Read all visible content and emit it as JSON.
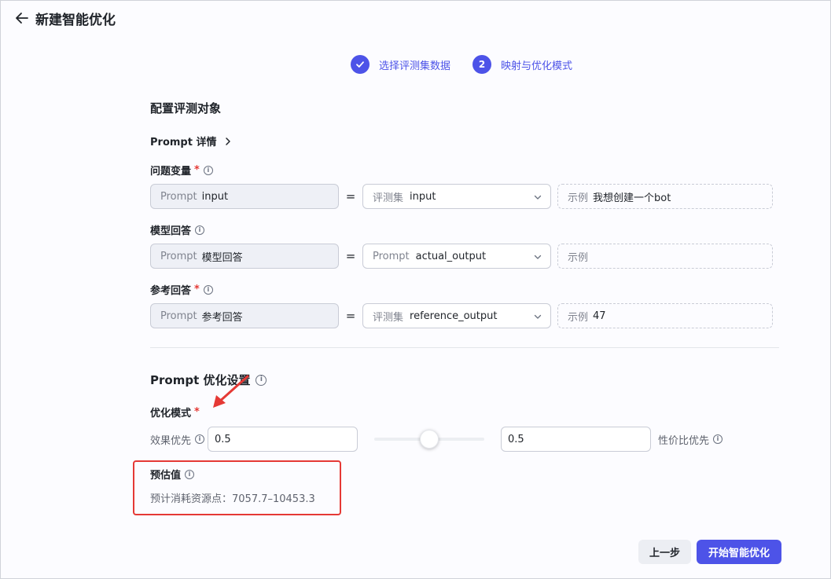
{
  "header": {
    "title": "新建智能优化"
  },
  "steps": [
    {
      "label": "选择评测集数据",
      "state": "done"
    },
    {
      "label": "映射与优化模式",
      "number": "2",
      "state": "active"
    }
  ],
  "eval_object": {
    "title": "配置评测对象",
    "prompt_detail": "Prompt 详情",
    "fields": [
      {
        "label": "问题变量",
        "required": "*",
        "left_prefix": "Prompt",
        "left_value": "input",
        "select_prefix": "评测集",
        "select_value": "input",
        "example_prefix": "示例",
        "example_value": "我想创建一个bot"
      },
      {
        "label": "模型回答",
        "required": "",
        "left_prefix": "Prompt",
        "left_value": "模型回答",
        "select_prefix": "Prompt",
        "select_value": "actual_output",
        "example_prefix": "示例",
        "example_value": ""
      },
      {
        "label": "参考回答",
        "required": "*",
        "left_prefix": "Prompt",
        "left_value": "参考回答",
        "select_prefix": "评测集",
        "select_value": "reference_output",
        "example_prefix": "示例",
        "example_value": "47"
      }
    ],
    "equals": "="
  },
  "optimize": {
    "title": "Prompt 优化设置",
    "mode_label": "优化模式",
    "required": "*",
    "left_label": "效果优先",
    "left_value": "0.5",
    "right_value": "0.5",
    "right_label": "性价比优先",
    "slider_level": 0.5
  },
  "estimate": {
    "title": "预估值",
    "text": "预计消耗资源点：7057.7–10453.3"
  },
  "footer": {
    "prev_label": "上一步",
    "start_label": "开始智能优化"
  },
  "colors": {
    "accent": "#4d53e8",
    "annotation_red": "#e53935"
  },
  "icons": {
    "back": "arrow-left-icon",
    "check": "check-icon",
    "chevron": "chevron-right-icon",
    "caret": "chevron-down-icon",
    "info": "info-icon"
  }
}
